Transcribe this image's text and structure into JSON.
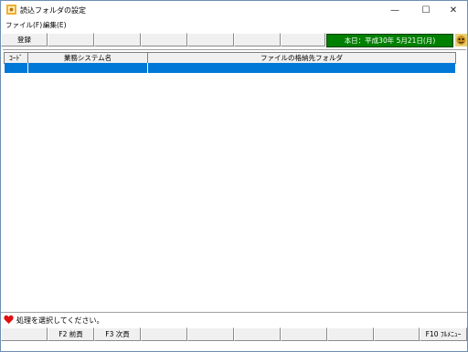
{
  "window": {
    "title": "読込フォルダの設定",
    "minimize_glyph": "—",
    "maximize_glyph": "☐",
    "close_glyph": "✕"
  },
  "menu": [
    "ファイル(F)",
    "編集(E)"
  ],
  "top_toolbar": {
    "keys": [
      "登録",
      "",
      "",
      "",
      "",
      "",
      ""
    ],
    "date_text": "本日：平成30年 5月21日(月)",
    "date_color": "#008000"
  },
  "grid": {
    "columns": [
      "ｺｰﾄﾞ",
      "業務システム名",
      "ファイルの格納先フォルダ"
    ],
    "selected_row_color": "#0078d7"
  },
  "status": {
    "icon": "heart-icon",
    "text": "処理を選択してください。"
  },
  "bottom_toolbar": {
    "keys": [
      "",
      "F2 前頁",
      "F3 次頁",
      "",
      "",
      "",
      "",
      "",
      "",
      "F10 ﾌﾙﾒﾆｭｰ"
    ]
  }
}
